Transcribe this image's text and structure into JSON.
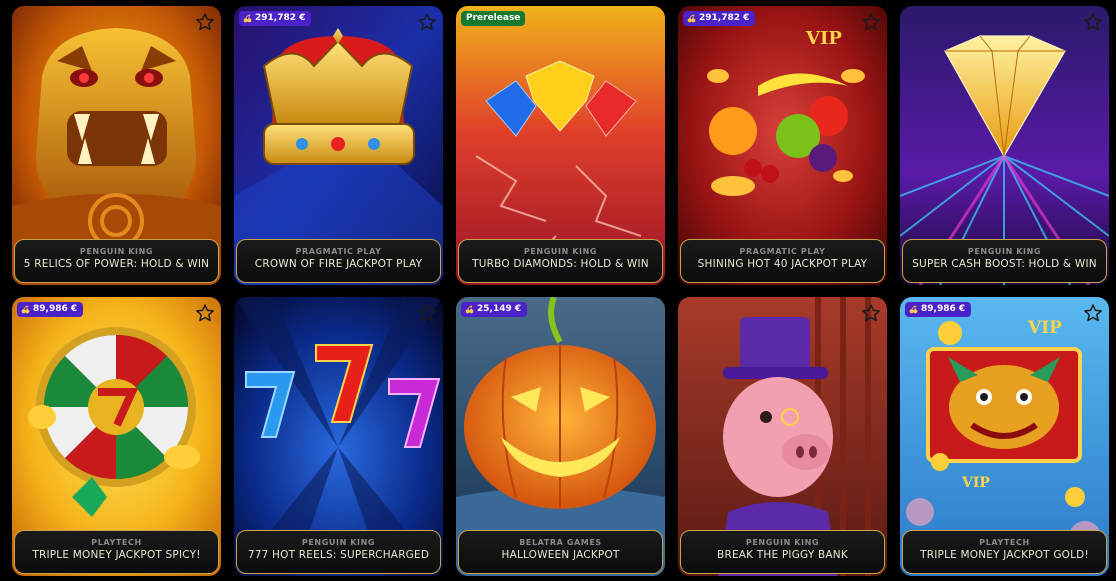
{
  "colors": {
    "background": "#000000",
    "plate_border": "#c9a24a",
    "badge_jackpot": "#4b22c8",
    "badge_prerelease": "#167a2e",
    "provider_text": "#8c8c8c",
    "title_text": "#ece6d6"
  },
  "favorite_icon": "star-outline-icon",
  "jackpot_icon": "cherries-icon",
  "games": [
    {
      "provider": "PENGUIN KING",
      "title": "5 RELICS OF POWER: HOLD & WIN",
      "badge": ""
    },
    {
      "provider": "PRAGMATIC PLAY",
      "title": "CROWN OF FIRE JACKPOT PLAY",
      "badge": "291,782 €"
    },
    {
      "provider": "PENGUIN KING",
      "title": "TURBO DIAMONDS: HOLD & WIN",
      "badge": "Prerelease"
    },
    {
      "provider": "PRAGMATIC PLAY",
      "title": "SHINING HOT 40 JACKPOT PLAY",
      "badge": "291,782 €"
    },
    {
      "provider": "PENGUIN KING",
      "title": "SUPER CASH BOOST: HOLD & WIN",
      "badge": ""
    },
    {
      "provider": "PLAYTECH",
      "title": "TRIPLE MONEY JACKPOT SPICY!",
      "badge": "89,986 €"
    },
    {
      "provider": "PENGUIN KING",
      "title": "777 HOT REELS: SUPERCHARGED",
      "badge": ""
    },
    {
      "provider": "BELATRA GAMES",
      "title": "HALLOWEEN JACKPOT",
      "badge": "25,149 €"
    },
    {
      "provider": "PENGUIN KING",
      "title": "BREAK THE PIGGY BANK",
      "badge": ""
    },
    {
      "provider": "PLAYTECH",
      "title": "TRIPLE MONEY JACKPOT GOLD!",
      "badge": "89,986 €"
    }
  ],
  "art_text": {
    "vip_1": "VIP",
    "vip_2": "VIP",
    "vip_3": "VIP"
  }
}
